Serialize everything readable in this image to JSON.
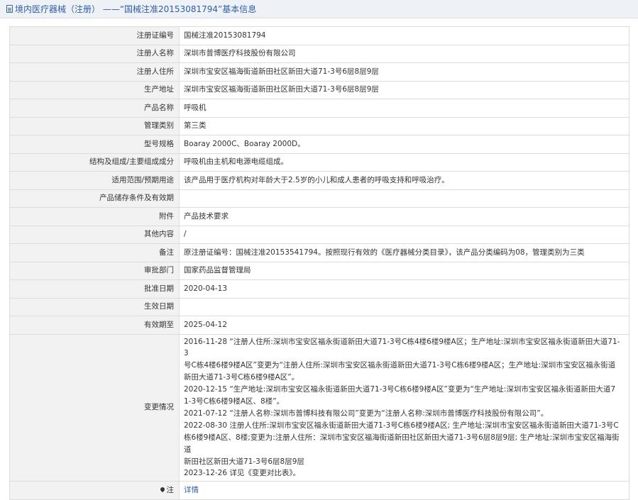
{
  "header": {
    "title": "境内医疗器械（注册） ——“国械注准20153081794”基本信息"
  },
  "rows": [
    {
      "label": "注册证编号",
      "value": "国械注准20153081794"
    },
    {
      "label": "注册人名称",
      "value": "深圳市普博医疗科技股份有限公司"
    },
    {
      "label": "注册人住所",
      "value": "深圳市宝安区福海街道新田社区新田大道71-3号6层8层9层"
    },
    {
      "label": "生产地址",
      "value": "深圳市宝安区福海街道新田社区新田大道71-3号6层8层9层"
    },
    {
      "label": "产品名称",
      "value": "呼吸机"
    },
    {
      "label": "管理类别",
      "value": "第三类"
    },
    {
      "label": "型号规格",
      "value": "Boaray 2000C、Boaray 2000D。"
    },
    {
      "label": "结构及组成/主要组成成分",
      "value": "呼吸机由主机和电源电缆组成。"
    },
    {
      "label": "适用范围/预期用途",
      "value": "该产品用于医疗机构对年龄大于2.5岁的小儿和成人患者的呼吸支持和呼吸治疗。"
    },
    {
      "label": "产品储存条件及有效期",
      "value": ""
    },
    {
      "label": "附件",
      "value": "产品技术要求"
    },
    {
      "label": "其他内容",
      "value": "/"
    },
    {
      "label": "备注",
      "value": "原注册证编号：国械注准20153541794。按照现行有效的《医疗器械分类目录》，该产品分类编码为08，管理类别为三类"
    },
    {
      "label": "审批部门",
      "value": "国家药品监督管理局"
    },
    {
      "label": "批准日期",
      "value": "2020-04-13"
    },
    {
      "label": "生效日期",
      "value": ""
    },
    {
      "label": "有效期至",
      "value": "2025-04-12"
    }
  ],
  "changes": {
    "label": "变更情况",
    "lines": [
      "2016-11-28 “注册人住所:深圳市宝安区福永街道新田大道71-3号C栋4楼6楼9楼A区；生产地址:深圳市宝安区福永街道新田大道71-3",
      "号C栋4楼6楼9楼A区”变更为“注册人住所:深圳市宝安区福永街道新田大道71-3号C栋6楼9楼A区；生产地址:深圳市宝安区福永街道",
      "新田大道71-3号C栋6楼9楼A区”。",
      "2020-12-15 “生产地址:深圳市宝安区福永街道新田大道71-3号C栋6楼9楼A区”变更为“生产地址:深圳市宝安区福永街道新田大道7",
      "1-3号C栋6楼9楼A区、8楼”。",
      "2021-07-12 “注册人名称:深圳市普博科技有限公司”变更为“注册人名称:深圳市普博医疗科技股份有限公司”。",
      "2022-08-30 注册人住所:深圳市宝安区福永街道新田大道71-3号C栋6楼9楼A区; 生产地址:深圳市宝安区福永街道新田大道71-3号C",
      "栋6楼9楼A区、8楼;变更为:注册人住所：深圳市宝安区福海街道新田社区新田大道71-3号6层8层9层; 生产地址:深圳市宝安区福海街道",
      "新田社区新田大道71-3号6层8层9层",
      "2023-12-26 详见《变更对比表》。"
    ]
  },
  "note": {
    "label": "注",
    "link_text": "详情"
  }
}
